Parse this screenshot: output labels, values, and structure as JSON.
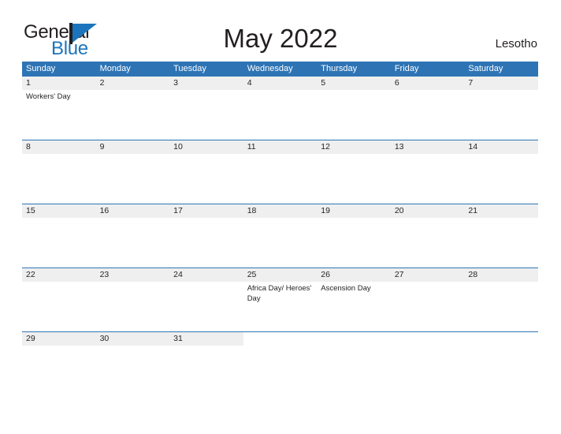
{
  "brand": {
    "word_one": "General",
    "word_two": "Blue",
    "mark": "triangle-flag-logo",
    "color_primary": "#1c75bc",
    "color_dark": "#231f20"
  },
  "header": {
    "title": "May 2022",
    "country": "Lesotho"
  },
  "theme": {
    "header_blue": "#2e74b5",
    "band_gray": "#efefef",
    "text": "#231f20"
  },
  "calendar": {
    "weekdays": [
      "Sunday",
      "Monday",
      "Tuesday",
      "Wednesday",
      "Thursday",
      "Friday",
      "Saturday"
    ],
    "weeks": [
      [
        {
          "day": "1",
          "holiday": "Workers' Day"
        },
        {
          "day": "2",
          "holiday": ""
        },
        {
          "day": "3",
          "holiday": ""
        },
        {
          "day": "4",
          "holiday": ""
        },
        {
          "day": "5",
          "holiday": ""
        },
        {
          "day": "6",
          "holiday": ""
        },
        {
          "day": "7",
          "holiday": ""
        }
      ],
      [
        {
          "day": "8",
          "holiday": ""
        },
        {
          "day": "9",
          "holiday": ""
        },
        {
          "day": "10",
          "holiday": ""
        },
        {
          "day": "11",
          "holiday": ""
        },
        {
          "day": "12",
          "holiday": ""
        },
        {
          "day": "13",
          "holiday": ""
        },
        {
          "day": "14",
          "holiday": ""
        }
      ],
      [
        {
          "day": "15",
          "holiday": ""
        },
        {
          "day": "16",
          "holiday": ""
        },
        {
          "day": "17",
          "holiday": ""
        },
        {
          "day": "18",
          "holiday": ""
        },
        {
          "day": "19",
          "holiday": ""
        },
        {
          "day": "20",
          "holiday": ""
        },
        {
          "day": "21",
          "holiday": ""
        }
      ],
      [
        {
          "day": "22",
          "holiday": ""
        },
        {
          "day": "23",
          "holiday": ""
        },
        {
          "day": "24",
          "holiday": ""
        },
        {
          "day": "25",
          "holiday": "Africa Day/ Heroes' Day"
        },
        {
          "day": "26",
          "holiday": "Ascension Day"
        },
        {
          "day": "27",
          "holiday": ""
        },
        {
          "day": "28",
          "holiday": ""
        }
      ],
      [
        {
          "day": "29",
          "holiday": ""
        },
        {
          "day": "30",
          "holiday": ""
        },
        {
          "day": "31",
          "holiday": ""
        },
        {
          "day": "",
          "holiday": ""
        },
        {
          "day": "",
          "holiday": ""
        },
        {
          "day": "",
          "holiday": ""
        },
        {
          "day": "",
          "holiday": ""
        }
      ]
    ]
  }
}
